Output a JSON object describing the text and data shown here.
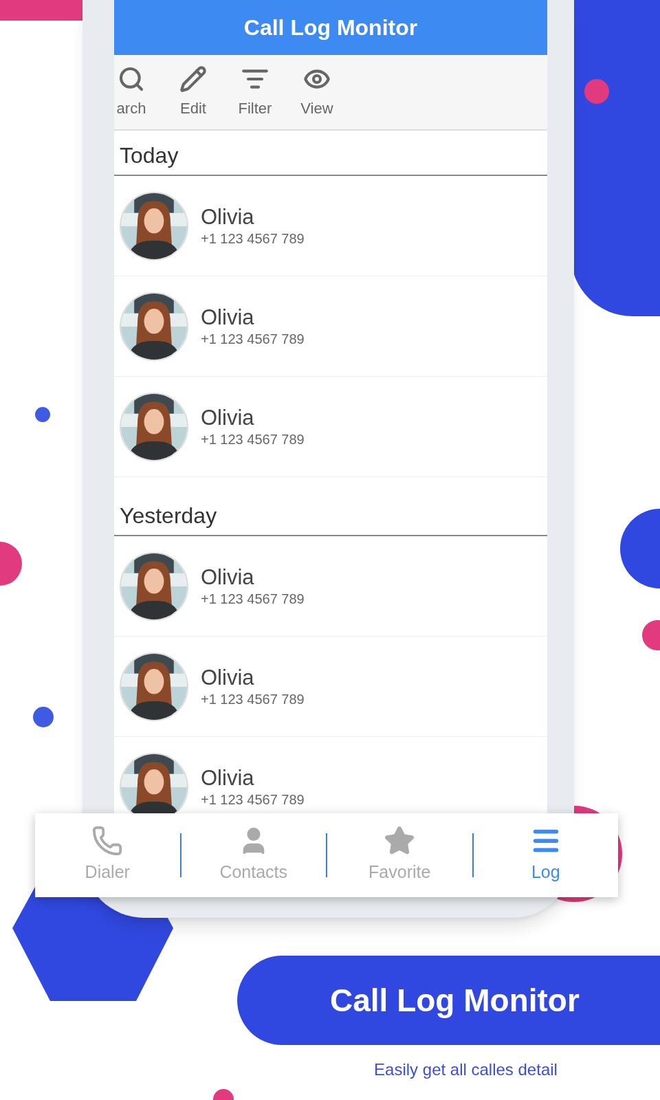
{
  "header": {
    "title": "Call Log Monitor"
  },
  "toolbar": [
    {
      "label": "arch"
    },
    {
      "label": "Edit"
    },
    {
      "label": "Filter"
    },
    {
      "label": "View"
    }
  ],
  "sections": [
    {
      "title": "Today",
      "calls": [
        {
          "name": "Olivia",
          "number": "+1 123 4567 789"
        },
        {
          "name": "Olivia",
          "number": "+1 123 4567 789"
        },
        {
          "name": "Olivia",
          "number": "+1 123 4567 789"
        }
      ]
    },
    {
      "title": "Yesterday",
      "calls": [
        {
          "name": "Olivia",
          "number": "+1 123 4567 789"
        },
        {
          "name": "Olivia",
          "number": "+1 123 4567 789"
        },
        {
          "name": "Olivia",
          "number": "+1 123 4567 789"
        }
      ]
    }
  ],
  "bottom_nav": [
    {
      "label": "Dialer",
      "selected": false
    },
    {
      "label": "Contacts",
      "selected": false
    },
    {
      "label": "Favorite",
      "selected": false
    },
    {
      "label": "Log",
      "selected": true
    }
  ],
  "banner": {
    "title": "Call Log Monitor",
    "subtitle": "Easily get all calles detail"
  }
}
